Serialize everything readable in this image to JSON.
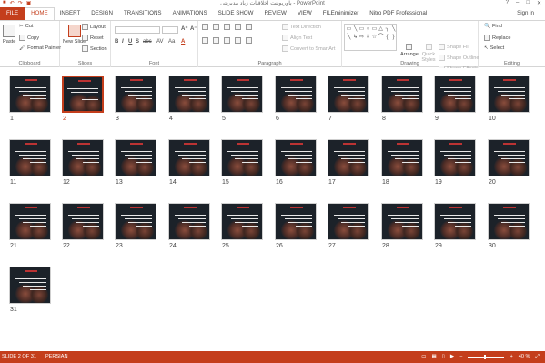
{
  "app": {
    "title": "پاورپوینت اخلاقیات زیاد مدیریتی - PowerPoint",
    "signin": "Sign in",
    "qat_icons": [
      "save-icon",
      "undo-icon",
      "redo-icon",
      "present-icon"
    ]
  },
  "tabs": [
    {
      "label": "FILE"
    },
    {
      "label": "HOME"
    },
    {
      "label": "INSERT"
    },
    {
      "label": "DESIGN"
    },
    {
      "label": "TRANSITIONS"
    },
    {
      "label": "ANIMATIONS"
    },
    {
      "label": "SLIDE SHOW"
    },
    {
      "label": "REVIEW"
    },
    {
      "label": "VIEW"
    },
    {
      "label": "FILEminimizer"
    },
    {
      "label": "Nitro PDF Professional"
    }
  ],
  "ribbon": {
    "clipboard": {
      "label": "Clipboard",
      "paste": "Paste",
      "cut": "Cut",
      "copy": "Copy",
      "format_painter": "Format Painter"
    },
    "slides": {
      "label": "Slides",
      "new_slide": "New Slide",
      "layout": "Layout",
      "reset": "Reset",
      "section": "Section"
    },
    "font": {
      "label": "Font",
      "bold": "B",
      "italic": "I",
      "underline": "U",
      "strike": "S",
      "shadow": "abc",
      "spacing": "AV",
      "case": "Aa",
      "color": "A"
    },
    "paragraph": {
      "label": "Paragraph",
      "text_direction": "Text Direction",
      "align_text": "Align Text",
      "smartart": "Convert to SmartArt"
    },
    "drawing": {
      "label": "Drawing",
      "arrange": "Arrange",
      "quick_styles": "Quick Styles",
      "shape_fill": "Shape Fill",
      "shape_outline": "Shape Outline",
      "shape_effects": "Shape Effects",
      "shapes": [
        "▭",
        "╲",
        "▭",
        "○",
        "▭",
        "△",
        "╮",
        "╲",
        "╲",
        "↳",
        "⇨",
        "⇩",
        "☆",
        "⌒",
        "{",
        "}",
        "☆"
      ]
    },
    "editing": {
      "label": "Editing",
      "find": "Find",
      "replace": "Replace",
      "select": "Select"
    }
  },
  "slides": {
    "selected": 2,
    "numbers": [
      "1",
      "2",
      "3",
      "4",
      "5",
      "6",
      "7",
      "8",
      "9",
      "10",
      "11",
      "12",
      "13",
      "14",
      "15",
      "16",
      "17",
      "18",
      "19",
      "20",
      "21",
      "22",
      "23",
      "24",
      "25",
      "26",
      "27",
      "28",
      "29",
      "30",
      "31"
    ]
  },
  "status": {
    "slide_info": "SLIDE 2 OF 31",
    "language": "PERSIAN",
    "zoom": "40 %"
  },
  "colors": {
    "accent": "#c43e1c",
    "slide_background": "#1c2229"
  }
}
